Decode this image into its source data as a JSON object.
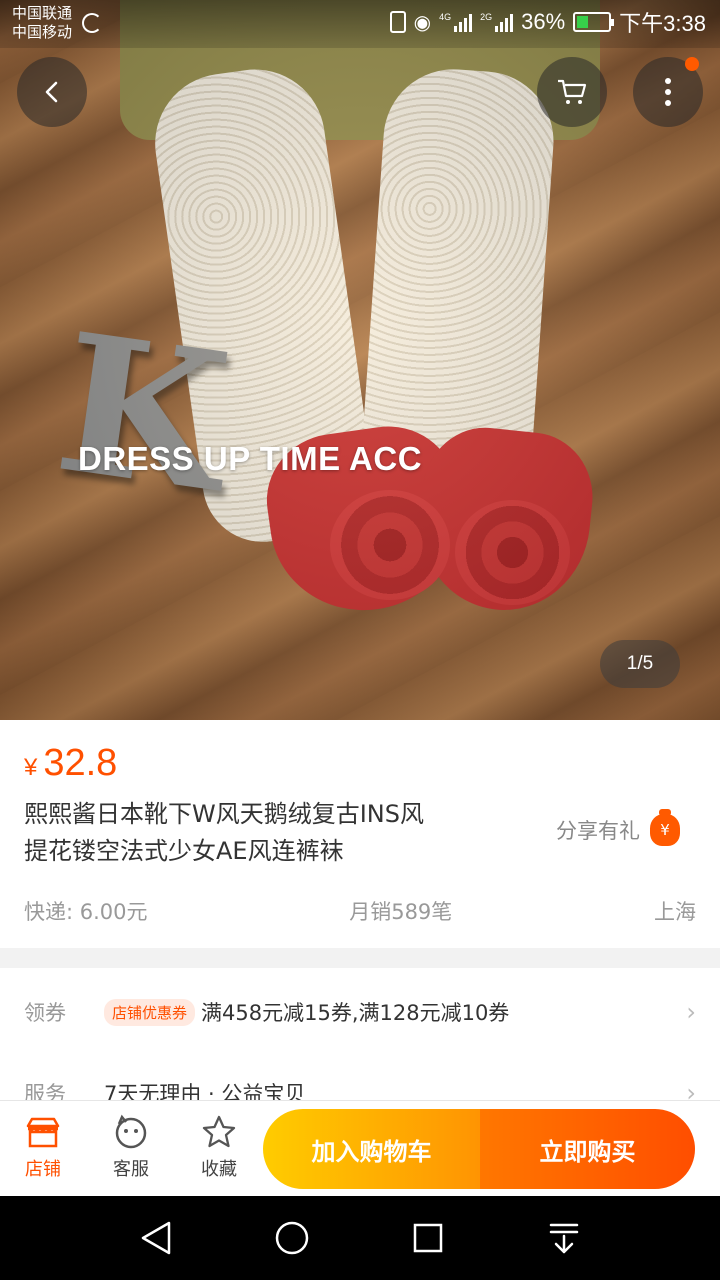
{
  "status_bar": {
    "carrier_1": "中国联通",
    "carrier_2": "中国移动",
    "net_1": "4G",
    "net_2": "2G",
    "battery": "36%",
    "time": "下午3:38"
  },
  "gallery": {
    "watermark": "DRESS UP TIME ACC",
    "letter": "K",
    "counter": "1/5"
  },
  "product": {
    "currency": "¥",
    "price": "32.8",
    "title_line1": "熙熙酱日本靴下W风天鹅绒复古INS风",
    "title_line2": "提花镂空法式少女AE风连裤袜",
    "share_label": "分享有礼",
    "shipping": "快递: 6.00元",
    "monthly_sales": "月销589笔",
    "location": "上海"
  },
  "coupons": {
    "label": "领券",
    "tag": "店铺优惠券",
    "text": "满458元减15券,满128元减10券"
  },
  "services": {
    "label": "服务",
    "text": "7天无理由 · 公益宝贝"
  },
  "actions": {
    "shop": "店铺",
    "service": "客服",
    "favorite": "收藏",
    "add_to_cart": "加入购物车",
    "buy_now": "立即购买"
  },
  "colors": {
    "accent": "#ff5000",
    "cart_button": "#ffa800",
    "buy_button": "#ff5a00"
  }
}
